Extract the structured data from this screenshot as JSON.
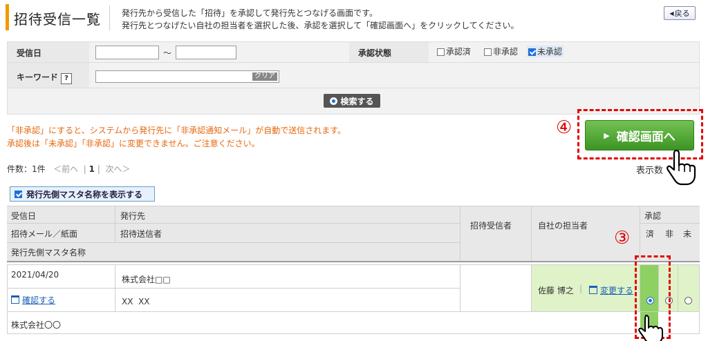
{
  "header": {
    "title": "招待受信一覧",
    "desc_line1": "発行先から受信した「招待」を承認して発行先とつなげる画面です。",
    "desc_line2": "発行先とつなげたい自社の担当者を選択した後、承認を選択して「確認画面へ」をクリックしてください。",
    "back_label": "戻る"
  },
  "search": {
    "received_date_label": "受信日",
    "date_from": "",
    "date_sep": "～",
    "date_to": "",
    "approval_status_label": "承認状態",
    "status_options": [
      {
        "label": "承認済",
        "checked": false
      },
      {
        "label": "非承認",
        "checked": false
      },
      {
        "label": "未承認",
        "checked": true
      }
    ],
    "keyword_label": "キーワード",
    "help_mark": "?",
    "keyword_value": "",
    "clear_label": "クリア",
    "search_button_label": "検索する"
  },
  "notice": {
    "line1": "「非承認」にすると、システムから発行先に「非承認通知メール」が自動で送信されます。",
    "line2": "承認後は「未承認」「非承認」に変更できません。ご注意ください。"
  },
  "confirm": {
    "button_label": "確認画面へ",
    "step_number": "④"
  },
  "pager": {
    "count_text": "件数：1件",
    "prev": "＜前へ",
    "current_page": "1",
    "next": "次へ＞",
    "display_count_text": "表示数"
  },
  "show_master_button": "発行先側マスタ名称を表示する",
  "table": {
    "headers": {
      "received_date": "受信日",
      "issuer": "発行先",
      "invite_receiver": "招待受信者",
      "own_person": "自社の担当者",
      "approval": "承認",
      "invite_mail": "招待メール／紙面",
      "invite_sender": "招待送信者",
      "done": "済",
      "reject": "非",
      "pending": "未",
      "master_name": "発行先側マスタ名称"
    },
    "rows": [
      {
        "received_date": "2021/04/20",
        "issuer": "株式会社□□",
        "confirm_link": "確認する",
        "sender": "XX  XX",
        "own_person": "佐藤 博之",
        "change_link": "変更する",
        "master_name": "株式会社〇〇",
        "approval": "done"
      }
    ]
  },
  "steps": {
    "step3": "③"
  },
  "colors": {
    "accent": "#f39800",
    "notice": "#e8670e",
    "confirm_green": "#4caf35",
    "highlight_red": "#e00000",
    "row_highlight": "#dff2c8"
  }
}
